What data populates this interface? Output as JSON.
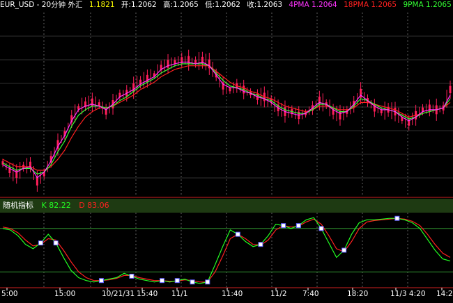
{
  "header": {
    "title": "EUR_USD - 20分钟 外汇",
    "prev": "1.1821",
    "open_label": "开:1.2062",
    "high_label": "高:1.2065",
    "low_label": "低:1.2062",
    "close_label": "收:1.2063",
    "ma4_label": "4PMA 1.2064",
    "ma18_label": "18PMA 1.2065",
    "ma9_label": "9PMA 1.2065"
  },
  "stoch": {
    "title": "随机指标",
    "k_label": "K 82.22",
    "d_label": "D 83.06"
  },
  "colors": {
    "background": "#000000",
    "candle": "#ff1f5a",
    "ma4": "#ff33ff",
    "ma9": "#33ff33",
    "ma18": "#ff2020",
    "k_line": "#22ff22",
    "d_line": "#ff2020",
    "grid": "#606060",
    "marker_fill": "#ffffff",
    "marker_edge": "#6060ff",
    "axis_text": "#ffffff",
    "level_line": "#ffffff"
  },
  "chart_data": [
    {
      "type": "line",
      "subtype": "candlestick-with-moving-averages",
      "title": "EUR_USD - 20分钟 外汇",
      "x_ticks": [
        "5:00",
        "15:00",
        "10/21/31",
        "15:40",
        "11/1",
        "11:40",
        "11/2",
        "7:40",
        "18:20",
        "11/3 4:20",
        "14:20"
      ],
      "series": [
        {
          "name": "price",
          "values": [
            18,
            14,
            12,
            16,
            17,
            8,
            12,
            20,
            28,
            34,
            42,
            48,
            50,
            51,
            50,
            46,
            50,
            55,
            56,
            59,
            62,
            64,
            66,
            70,
            72,
            73,
            74,
            74,
            73,
            74,
            72,
            66,
            60,
            58,
            60,
            58,
            56,
            54,
            54,
            52,
            48,
            46,
            46,
            44,
            45,
            48,
            52,
            50,
            46,
            44,
            46,
            50,
            56,
            52,
            48,
            46,
            47,
            46,
            42,
            40,
            44,
            47,
            48,
            47,
            48,
            58
          ],
          "ylim": [
            0,
            100
          ]
        },
        {
          "name": "4PMA",
          "values": [
            17,
            15,
            13,
            15,
            16,
            10,
            13,
            19,
            27,
            33,
            41,
            47,
            49,
            50,
            49,
            47,
            50,
            54,
            56,
            58,
            61,
            63,
            65,
            69,
            71,
            72,
            73,
            73,
            72,
            73,
            71,
            66,
            61,
            59,
            59,
            57,
            56,
            54,
            53,
            51,
            48,
            46,
            45,
            44,
            45,
            48,
            51,
            50,
            47,
            45,
            46,
            50,
            55,
            52,
            49,
            47,
            47,
            46,
            43,
            41,
            43,
            46,
            47,
            47,
            48,
            55
          ]
        },
        {
          "name": "9PMA",
          "values": [
            18,
            16,
            14,
            15,
            15,
            12,
            13,
            17,
            24,
            30,
            38,
            44,
            47,
            49,
            49,
            48,
            49,
            52,
            54,
            57,
            60,
            62,
            64,
            67,
            69,
            71,
            72,
            72,
            72,
            72,
            71,
            67,
            63,
            60,
            59,
            58,
            56,
            55,
            53,
            52,
            49,
            47,
            46,
            45,
            45,
            47,
            50,
            50,
            48,
            46,
            46,
            49,
            53,
            52,
            50,
            48,
            47,
            46,
            44,
            42,
            43,
            45,
            46,
            47,
            48,
            53
          ]
        },
        {
          "name": "18PMA",
          "values": [
            20,
            18,
            16,
            16,
            16,
            14,
            14,
            16,
            20,
            25,
            32,
            38,
            43,
            46,
            48,
            48,
            49,
            51,
            53,
            55,
            58,
            60,
            62,
            65,
            67,
            69,
            70,
            71,
            71,
            71,
            71,
            68,
            65,
            62,
            60,
            59,
            57,
            56,
            54,
            53,
            51,
            49,
            48,
            47,
            46,
            47,
            49,
            49,
            48,
            47,
            47,
            48,
            51,
            51,
            50,
            49,
            48,
            47,
            45,
            43,
            44,
            45,
            46,
            47,
            48,
            51
          ]
        }
      ]
    },
    {
      "type": "line",
      "title": "随机指标",
      "ylim": [
        0,
        100
      ],
      "levels": [
        80,
        20
      ],
      "series": [
        {
          "name": "K",
          "values": [
            80,
            78,
            70,
            58,
            52,
            60,
            72,
            60,
            40,
            22,
            12,
            8,
            6,
            8,
            10,
            12,
            18,
            14,
            10,
            8,
            6,
            8,
            6,
            8,
            10,
            6,
            4,
            6,
            30,
            55,
            78,
            72,
            62,
            55,
            58,
            70,
            86,
            84,
            80,
            84,
            92,
            95,
            80,
            60,
            40,
            50,
            72,
            88,
            92,
            92,
            93,
            94,
            94,
            92,
            88,
            80,
            65,
            50,
            38,
            35
          ]
        },
        {
          "name": "D",
          "values": [
            82,
            80,
            74,
            64,
            56,
            58,
            66,
            64,
            50,
            34,
            20,
            12,
            8,
            8,
            9,
            11,
            15,
            15,
            12,
            10,
            8,
            8,
            7,
            7,
            9,
            8,
            6,
            6,
            20,
            42,
            66,
            72,
            66,
            58,
            57,
            64,
            78,
            84,
            82,
            83,
            89,
            93,
            86,
            70,
            52,
            48,
            62,
            80,
            89,
            91,
            92,
            93,
            94,
            93,
            90,
            84,
            72,
            58,
            46,
            40
          ]
        }
      ]
    }
  ]
}
